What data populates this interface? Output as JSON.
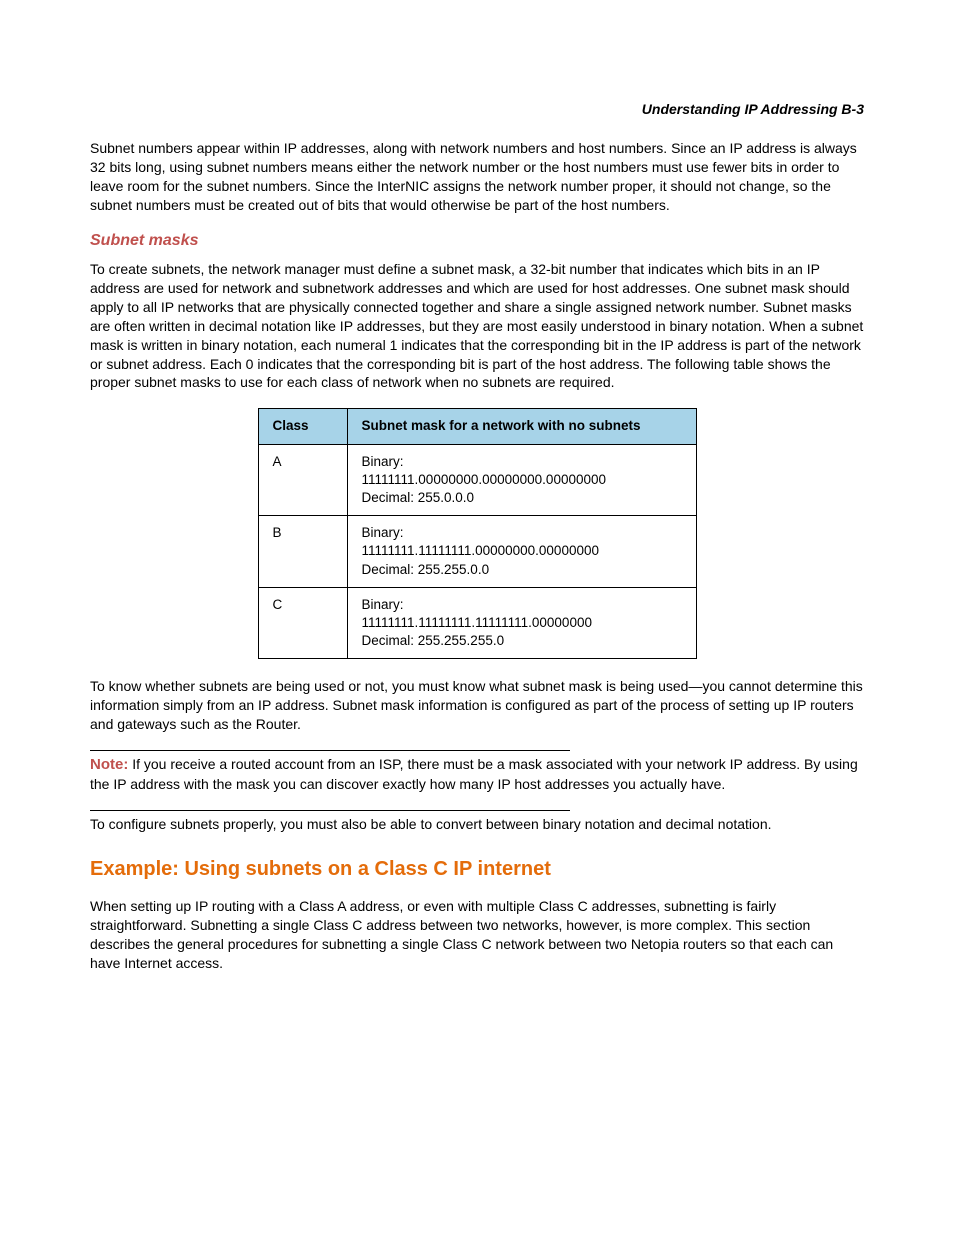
{
  "header": {
    "title": "Understanding IP Addressing  B-3"
  },
  "intro": {
    "p1": "Subnet numbers appear within IP addresses, along with network numbers and host numbers. Since an IP address is always 32 bits long, using subnet numbers means either the network number or the host numbers must use fewer bits in order to leave room for the subnet numbers. Since the InterNIC assigns the network number proper, it should not change, so the subnet numbers must be created out of bits that would otherwise be part of the host numbers."
  },
  "subnet_masks": {
    "heading": "Subnet masks",
    "p1": "To create subnets, the network manager must define a subnet mask, a 32-bit number that indicates which bits in an IP address are used for network and subnetwork addresses and which are used for host addresses. One subnet mask should apply to all IP networks that are physically connected together and share a single assigned network number. Subnet masks are often written in decimal notation like IP addresses, but they are most easily understood in binary notation. When a subnet mask is written in binary notation, each numeral 1 indicates that the corresponding bit in the IP address is part of the network or subnet address. Each 0 indicates that the corresponding bit is part of the host address. The following table shows the proper subnet masks to use for each class of network when no subnets are required.",
    "table": {
      "headers": {
        "class": "Class",
        "mask": "Subnet mask for a network with no subnets"
      },
      "rows": [
        {
          "class": "A",
          "binary_label": "Binary:",
          "binary": "11111111.00000000.00000000.00000000",
          "decimal": "Decimal: 255.0.0.0"
        },
        {
          "class": "B",
          "binary_label": "Binary:",
          "binary": "11111111.11111111.00000000.00000000",
          "decimal": "Decimal: 255.255.0.0"
        },
        {
          "class": "C",
          "binary_label": "Binary:",
          "binary": "11111111.11111111.11111111.00000000",
          "decimal": "Decimal: 255.255.255.0"
        }
      ]
    },
    "p2": "To know whether subnets are being used or not, you must know what subnet mask is being used—you cannot determine this information simply from an IP address. Subnet mask information is configured as part of the process of setting up IP routers and gateways such as the Router.",
    "note_label": "Note:",
    "note_body": " If you receive a routed account from an ISP, there must be a mask associated with your network IP address. By using the IP address with the mask you can discover exactly how many IP host addresses you actually have.",
    "p3": "To configure subnets properly, you must also be able to convert between binary notation and decimal notation."
  },
  "example": {
    "heading": "Example: Using subnets on a Class C IP internet",
    "p1": "When setting up IP routing with a Class A address, or even with multiple Class C addresses, subnetting is fairly straightforward. Subnetting a single Class C address between two networks, however, is more complex. This section describes the general procedures for subnetting a single Class C network between two Netopia routers so that each can have Internet access."
  }
}
